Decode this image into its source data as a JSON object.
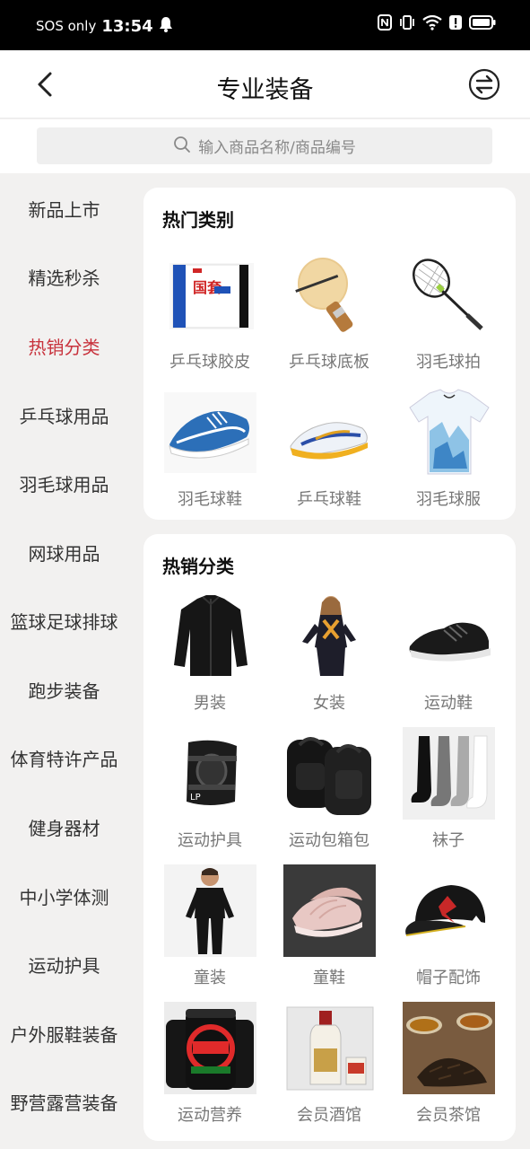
{
  "status": {
    "carrier": "SOS only",
    "time": "13:54"
  },
  "header": {
    "title": "专业装备"
  },
  "search": {
    "placeholder": "输入商品名称/商品编号"
  },
  "sidebar": {
    "items": [
      {
        "label": "新品上市"
      },
      {
        "label": "精选秒杀"
      },
      {
        "label": "热销分类"
      },
      {
        "label": "乒乓球用品"
      },
      {
        "label": "羽毛球用品"
      },
      {
        "label": "网球用品"
      },
      {
        "label": "篮球足球排球"
      },
      {
        "label": "跑步装备"
      },
      {
        "label": "体育特许产品"
      },
      {
        "label": "健身器材"
      },
      {
        "label": "中小学体测"
      },
      {
        "label": "运动护具"
      },
      {
        "label": "户外服鞋装备"
      },
      {
        "label": "野营露营装备"
      }
    ],
    "active_color": "#c8323c"
  },
  "hot_categories": {
    "title": "热门类别",
    "items": [
      {
        "label": "乒乓球胶皮",
        "icon": "rubber-sheet-image"
      },
      {
        "label": "乒乓球底板",
        "icon": "paddle-blade-image"
      },
      {
        "label": "羽毛球拍",
        "icon": "badminton-racket-image"
      },
      {
        "label": "羽毛球鞋",
        "icon": "badminton-shoe-image"
      },
      {
        "label": "乒乓球鞋",
        "icon": "table-tennis-shoe-image"
      },
      {
        "label": "羽毛球服",
        "icon": "badminton-shirt-image"
      }
    ]
  },
  "hot_sales": {
    "title": "热销分类",
    "items": [
      {
        "label": "男装",
        "icon": "jacket-image"
      },
      {
        "label": "女装",
        "icon": "womens-wear-image"
      },
      {
        "label": "运动鞋",
        "icon": "sneaker-image"
      },
      {
        "label": "运动护具",
        "icon": "knee-brace-image"
      },
      {
        "label": "运动包箱包",
        "icon": "backpack-image"
      },
      {
        "label": "袜子",
        "icon": "socks-image"
      },
      {
        "label": "童装",
        "icon": "kids-wear-image"
      },
      {
        "label": "童鞋",
        "icon": "kids-shoe-image"
      },
      {
        "label": "帽子配饰",
        "icon": "cap-image"
      },
      {
        "label": "运动营养",
        "icon": "protein-tub-image"
      },
      {
        "label": "会员酒馆",
        "icon": "liquor-bottle-image"
      },
      {
        "label": "会员茶馆",
        "icon": "tea-cups-image"
      }
    ]
  }
}
